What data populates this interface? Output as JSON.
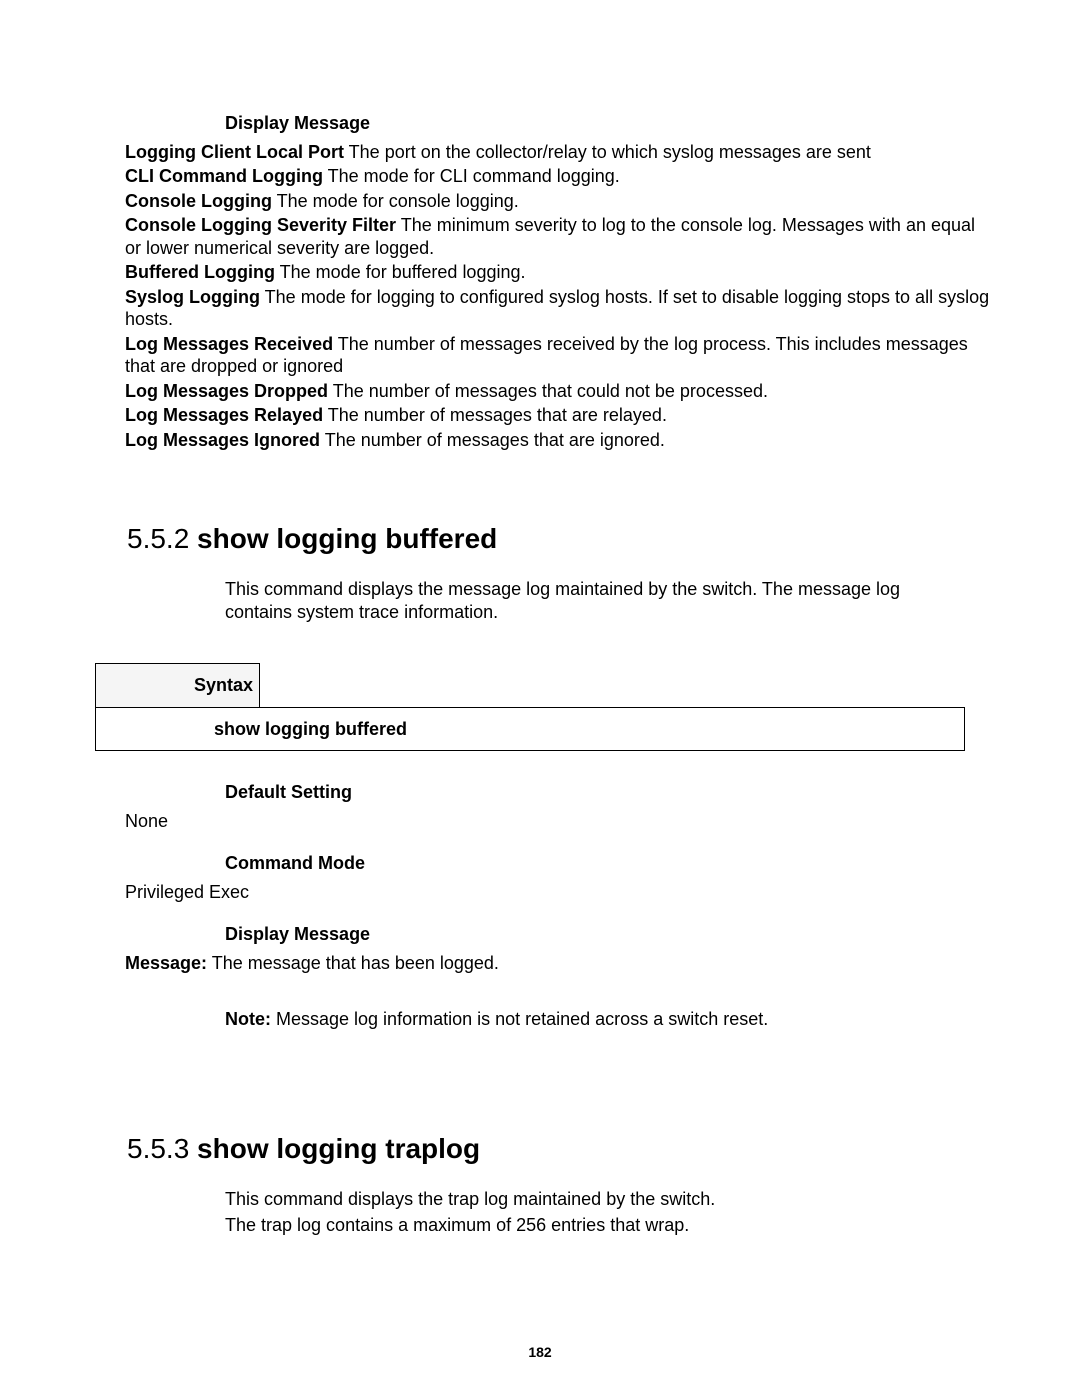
{
  "top": {
    "sectionLabel": "Display Message",
    "definitions": [
      {
        "term": "Logging Client Local Port",
        "desc": " The port on the collector/relay to which syslog messages are sent"
      },
      {
        "term": "CLI Command Logging",
        "desc": " The mode for CLI command logging."
      },
      {
        "term": "Console Logging",
        "desc": " The mode for console logging."
      },
      {
        "term": "Console Logging Severity Filter",
        "desc": " The minimum severity to log to the console log. Messages with an equal or lower numerical severity are logged."
      },
      {
        "term": "Buffered Logging",
        "desc": " The mode for buffered logging."
      },
      {
        "term": "Syslog Logging",
        "desc": " The mode for logging to configured syslog hosts. If set to disable logging stops to all syslog hosts."
      },
      {
        "term": "Log Messages Received",
        "desc": " The number of messages received by the log process. This includes messages that are dropped or ignored"
      },
      {
        "term": "Log Messages Dropped",
        "desc": " The number of messages that could not be processed."
      },
      {
        "term": "Log Messages Relayed",
        "desc": " The number of messages that are relayed."
      },
      {
        "term": "Log Messages Ignored",
        "desc": " The number of messages that are ignored."
      }
    ]
  },
  "s552": {
    "number": "5.5.2",
    "title": " show logging buffered",
    "description": "This command displays the message log maintained by the switch. The message log contains system trace information.",
    "syntaxLabel": "Syntax",
    "syntaxBody": "show logging buffered",
    "defaultLabel": "Default Setting",
    "defaultValue": "None",
    "modeLabel": "Command Mode",
    "modeValue": "Privileged Exec",
    "displayLabel": "Display Message",
    "messageTerm": "Message:",
    "messageDesc": " The message that has been logged.",
    "noteTerm": "Note:",
    "noteDesc": " Message log information is not retained across a switch reset."
  },
  "s553": {
    "number": "5.5.3",
    "title": " show logging traplog",
    "descLine1": "This command displays the trap log maintained by the switch.",
    "descLine2": "The trap log contains a maximum of 256 entries that wrap."
  },
  "pageNumber": "182"
}
